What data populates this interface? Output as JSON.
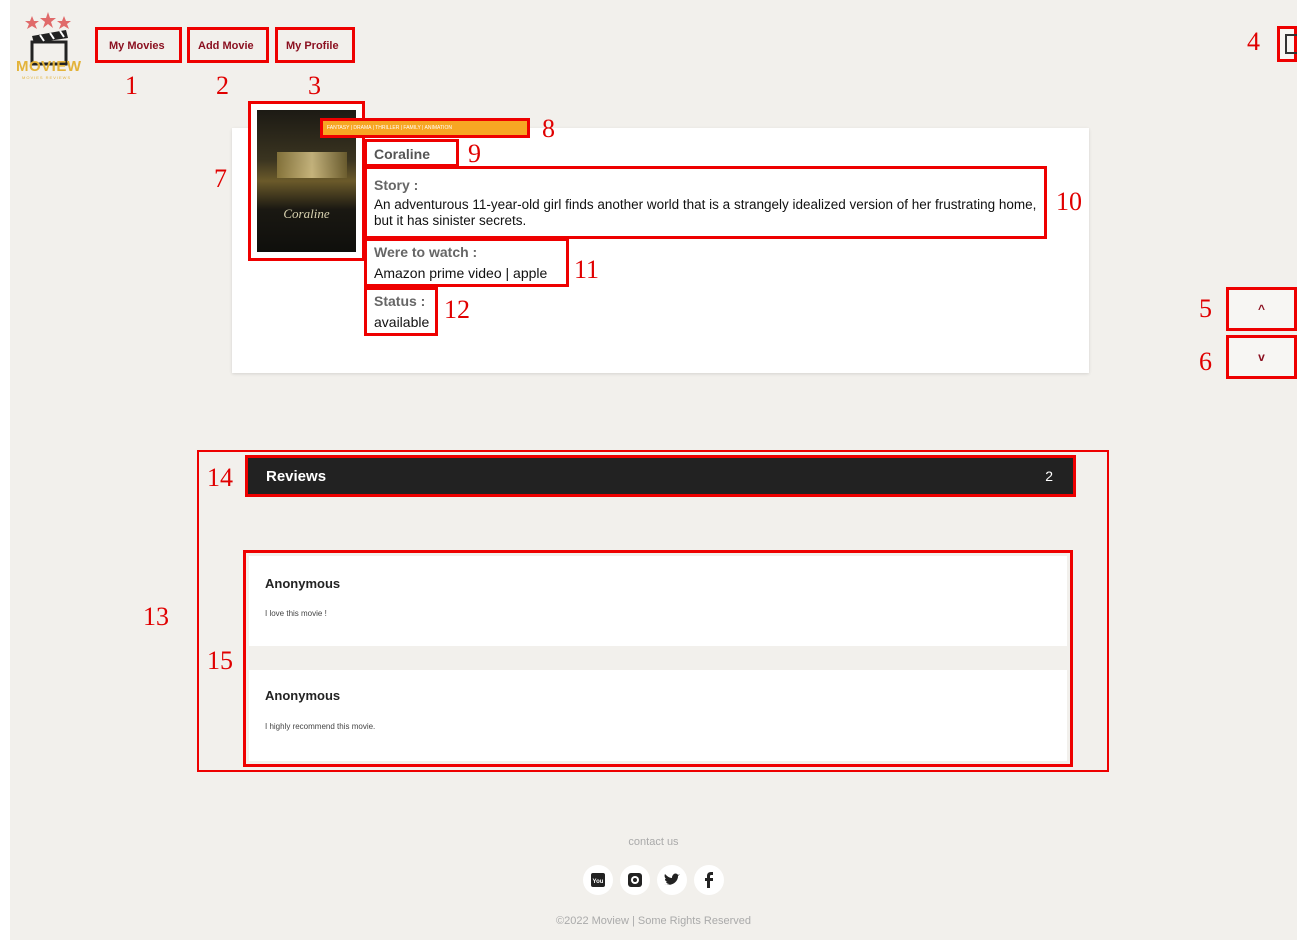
{
  "header": {
    "logo_text": "MOVIEW",
    "logo_tagline": "MOVIES REVIEWS",
    "nav": [
      "My Movies",
      "Add Movie",
      "My Profile"
    ]
  },
  "controls": {
    "scroll_up": "^",
    "scroll_down": "v"
  },
  "movie": {
    "poster_title": "Coraline",
    "genres": "FANTASY | DRAMA | THRILLER | FAMILY | ANIMATION",
    "title": "Coraline",
    "story_label": "Story :",
    "story": "An adventurous 11-year-old girl finds another world that is a strangely idealized version of her frustrating home, but it has sinister secrets.",
    "watch_label": "Were to watch :",
    "watch": "Amazon prime video | apple",
    "status_label": "Status :",
    "status": "available"
  },
  "reviews": {
    "label": "Reviews",
    "count": "2",
    "items": [
      {
        "author": "Anonymous",
        "text": "I love this movie !"
      },
      {
        "author": "Anonymous",
        "text": "I highly recommend this movie."
      }
    ]
  },
  "footer": {
    "contact": "contact us",
    "social": [
      "youtube-icon",
      "instagram-icon",
      "twitter-icon",
      "facebook-icon"
    ],
    "copyright": "©2022 Moview | Some Rights Reserved"
  },
  "annotations": [
    "1",
    "2",
    "3",
    "4",
    "5",
    "6",
    "7",
    "8",
    "9",
    "10",
    "11",
    "12",
    "13",
    "14",
    "15"
  ],
  "colors": {
    "accent": "#8b1020",
    "genre_bg": "#f7a623",
    "header_bg": "#222222",
    "annotation": "#ee0000"
  }
}
